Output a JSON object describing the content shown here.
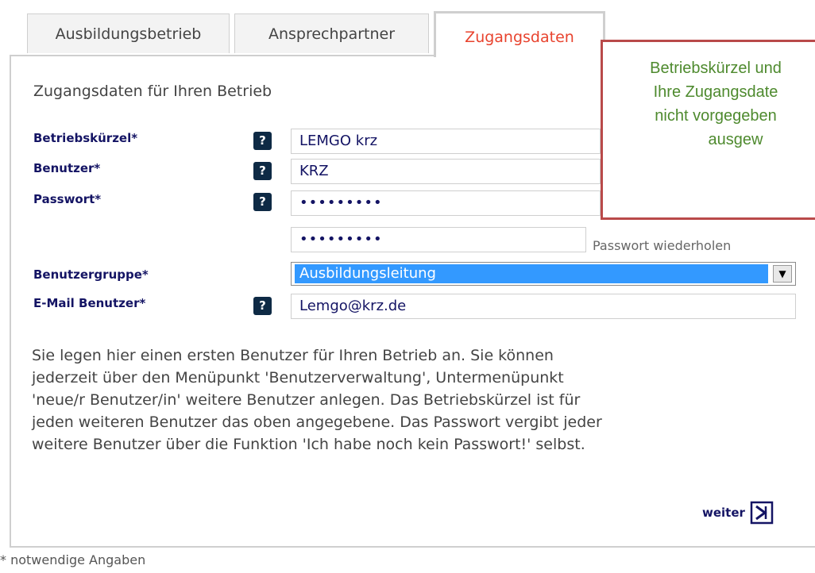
{
  "tabs": [
    {
      "label": "Ausbildungsbetrieb"
    },
    {
      "label": "Ansprechpartner"
    },
    {
      "label": "Zugangsdaten",
      "active": true
    }
  ],
  "form": {
    "title": "Zugangsdaten für Ihren Betrieb",
    "help_symbol": "?",
    "fields": {
      "kuerzel": {
        "label": "Betriebskürzel*",
        "value": "LEMGO krz"
      },
      "benutzer": {
        "label": "Benutzer*",
        "value": "KRZ"
      },
      "passwort": {
        "label": "Passwort*",
        "value": "•••••••••"
      },
      "passwort_wdh": {
        "value": "•••••••••",
        "hint": "Passwort wiederholen"
      },
      "gruppe": {
        "label": "Benutzergruppe*",
        "value": "Ausbildungsleitung",
        "arrow": "▼"
      },
      "email": {
        "label": "E-Mail Benutzer*",
        "value": "Lemgo@krz.de"
      }
    },
    "description_lines": [
      "Sie legen hier einen ersten Benutzer für Ihren Betrieb an. Sie können",
      "jederzeit über den Menüpunkt 'Benutzerverwaltung', Untermenüpunkt",
      "'neue/r Benutzer/in' weitere Benutzer anlegen. Das Betriebskürzel ist für",
      "jeden weiteren Benutzer das oben angegebene. Das Passwort vergibt jeder",
      "weitere Benutzer über die Funktion 'Ich habe noch kein Passwort!' selbst."
    ],
    "next_label": "weiter"
  },
  "callout": {
    "lines": [
      "Betriebskürzel und",
      "Ihre Zugangsdate",
      "nicht vorgegeben",
      "ausgew"
    ]
  },
  "footnote": "* notwendige Angaben",
  "colors": {
    "active_tab": "#e8432e",
    "label": "#141464",
    "select_highlight": "#3399ff",
    "callout_border": "#b94a4a",
    "callout_text": "#4e8a2e"
  }
}
